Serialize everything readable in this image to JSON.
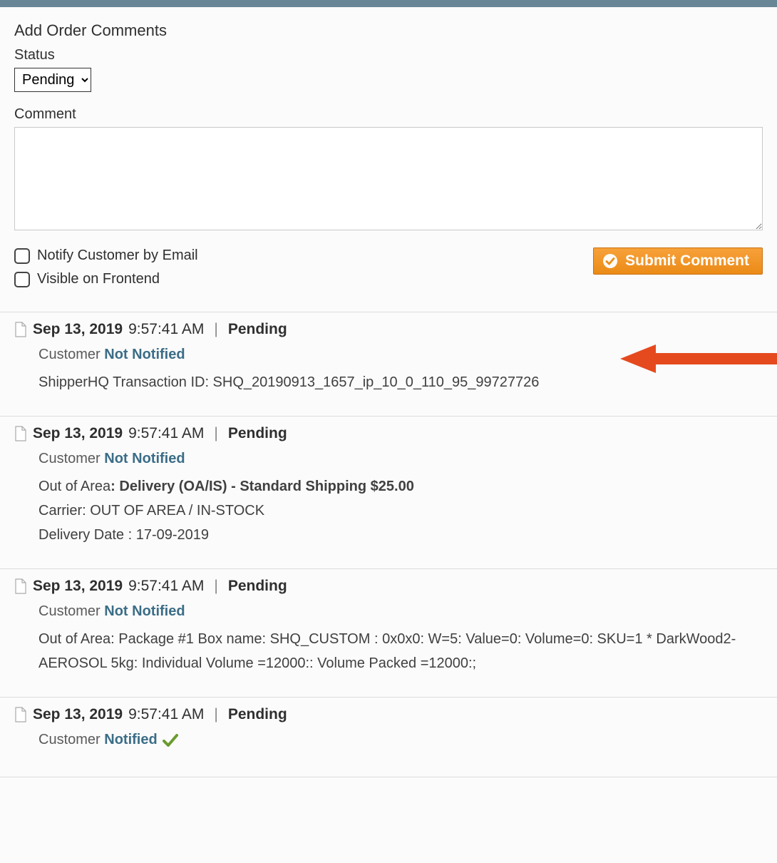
{
  "form": {
    "heading": "Add Order Comments",
    "statusLabel": "Status",
    "statusValue": "Pending",
    "commentLabel": "Comment",
    "commentValue": "",
    "notifyLabel": "Notify Customer by Email",
    "visibleLabel": "Visible on Frontend",
    "submitLabel": "Submit Comment"
  },
  "history": [
    {
      "date": "Sep 13, 2019",
      "time": "9:57:41 AM",
      "status": "Pending",
      "customerLabel": "Customer",
      "notifState": "Not Notified",
      "notifIcon": "none",
      "body": "ShipperHQ Transaction ID: SHQ_20190913_1657_ip_10_0_110_95_99727726",
      "highlighted": true
    },
    {
      "date": "Sep 13, 2019",
      "time": "9:57:41 AM",
      "status": "Pending",
      "customerLabel": "Customer",
      "notifState": "Not Notified",
      "notifIcon": "none",
      "bodyPrefix": "Out of Area",
      "bodyBold": ": Delivery (OA/IS) - Standard Shipping $25.00",
      "bodyLines": [
        "Carrier: OUT OF AREA / IN-STOCK",
        "Delivery Date : 17-09-2019"
      ]
    },
    {
      "date": "Sep 13, 2019",
      "time": "9:57:41 AM",
      "status": "Pending",
      "customerLabel": "Customer",
      "notifState": "Not Notified",
      "notifIcon": "none",
      "body": "Out of Area: Package #1 Box name: SHQ_CUSTOM : 0x0x0: W=5: Value=0: Volume=0: SKU=1 * DarkWood2-AEROSOL 5kg: Individual Volume =12000:: Volume Packed =12000:;"
    },
    {
      "date": "Sep 13, 2019",
      "time": "9:57:41 AM",
      "status": "Pending",
      "customerLabel": "Customer",
      "notifState": "Notified",
      "notifIcon": "check",
      "body": ""
    }
  ]
}
